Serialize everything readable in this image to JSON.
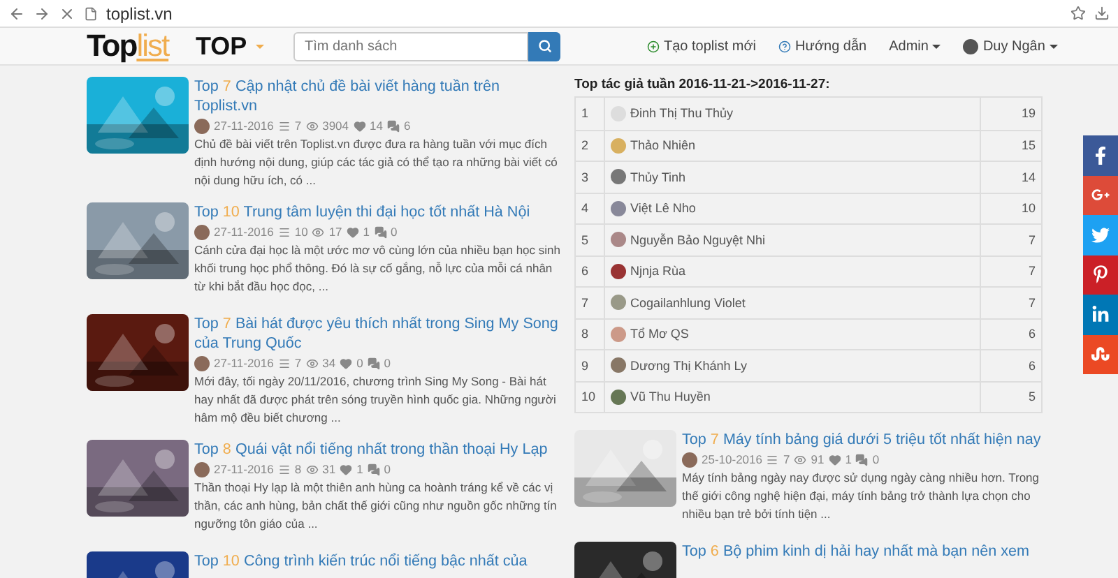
{
  "browser": {
    "url": "toplist.vn"
  },
  "navbar": {
    "logo": {
      "dark": "Top",
      "light": "list"
    },
    "menu": "TOP",
    "search": {
      "placeholder": "Tìm danh sách"
    },
    "links": [
      "Tạo toplist mới",
      "Hướng dẫn"
    ],
    "admin": "Admin",
    "user": "Duy Ngân"
  },
  "posts_left": [
    {
      "top": "Top",
      "count": "7",
      "title": "Cập nhật chủ đề bài viết hàng tuần trên Toplist.vn",
      "date": "27-11-2016",
      "items": "7",
      "views": "3904",
      "likes": "14",
      "comments": "6",
      "excerpt": "Chủ đề bài viết trên Toplist.vn được đưa ra hàng tuần với mục đích định hướng nội dung, giúp các tác giả có thể tạo ra những bài viết có nội dung hữu ích, có ..."
    },
    {
      "top": "Top",
      "count": "10",
      "title": "Trung tâm luyện thi đại học tốt nhất Hà Nội",
      "date": "27-11-2016",
      "items": "10",
      "views": "17",
      "likes": "1",
      "comments": "0",
      "excerpt": "Cánh cửa đại học là một ước mơ vô cùng lớn của nhiều bạn học sinh khối trung học phổ thông. Đó là sự cố gắng, nỗ lực của mỗi cá nhân từ khi bắt đầu học đọc, ..."
    },
    {
      "top": "Top",
      "count": "7",
      "title": "Bài hát được yêu thích nhất trong Sing My Song của Trung Quốc",
      "date": "27-11-2016",
      "items": "7",
      "views": "34",
      "likes": "0",
      "comments": "0",
      "excerpt": "Mới đây, tối ngày 20/11/2016, chương trình Sing My Song - Bài hát hay nhất đã được phát trên sóng truyền hình quốc gia. Những người hâm mộ đều biết chương ..."
    },
    {
      "top": "Top",
      "count": "8",
      "title": "Quái vật nổi tiếng nhất trong thần thoại Hy Lạp",
      "date": "27-11-2016",
      "items": "8",
      "views": "31",
      "likes": "1",
      "comments": "0",
      "excerpt": "Thần thoại Hy lạp là một thiên anh hùng ca hoành tráng kể về các vị thần, các anh hùng, bản chất thế giới cũng như nguồn gốc những tín ngưỡng tôn giáo của ..."
    },
    {
      "top": "Top",
      "count": "10",
      "title": "Công trình kiến trúc nổi tiếng bậc nhất của"
    }
  ],
  "authors": {
    "title": "Top tác giả tuần 2016-11-21->2016-11-27:",
    "rows": [
      {
        "rank": "1",
        "name": "Đinh Thị Thu Thủy",
        "score": "19"
      },
      {
        "rank": "2",
        "name": "Thảo Nhiên",
        "score": "15"
      },
      {
        "rank": "3",
        "name": "Thủy Tinh",
        "score": "14"
      },
      {
        "rank": "4",
        "name": "Việt Lê Nho",
        "score": "10"
      },
      {
        "rank": "5",
        "name": "Nguyễn Bảo Nguyệt Nhi",
        "score": "7"
      },
      {
        "rank": "6",
        "name": "Njnja Rùa",
        "score": "7"
      },
      {
        "rank": "7",
        "name": "Cogailanhlung Violet",
        "score": "7"
      },
      {
        "rank": "8",
        "name": "Tổ Mơ QS",
        "score": "6"
      },
      {
        "rank": "9",
        "name": "Dương Thị Khánh Ly",
        "score": "6"
      },
      {
        "rank": "10",
        "name": "Vũ Thu Huyền",
        "score": "5"
      }
    ]
  },
  "posts_right": [
    {
      "top": "Top",
      "count": "7",
      "title": "Máy tính bảng giá dưới 5 triệu tốt nhất hiện nay",
      "date": "25-10-2016",
      "items": "7",
      "views": "91",
      "likes": "1",
      "comments": "0",
      "excerpt": "Máy tính bảng ngày nay được sử dụng ngày càng nhiều hơn. Trong thế giới công nghệ hiện đại, máy tính bảng trở thành lựa chọn cho nhiều bạn trẻ bởi tính tiện ..."
    },
    {
      "top": "Top",
      "count": "6",
      "title": "Bộ phim kinh dị hải hay nhất mà bạn nên xem"
    }
  ],
  "social": [
    {
      "kind": "facebook",
      "color": "#3b5998"
    },
    {
      "kind": "googleplus",
      "color": "#dd4b39"
    },
    {
      "kind": "twitter",
      "color": "#1da1f2"
    },
    {
      "kind": "pinterest",
      "color": "#cb2027"
    },
    {
      "kind": "linkedin",
      "color": "#0077b5"
    },
    {
      "kind": "stumbleupon",
      "color": "#eb4924"
    }
  ]
}
